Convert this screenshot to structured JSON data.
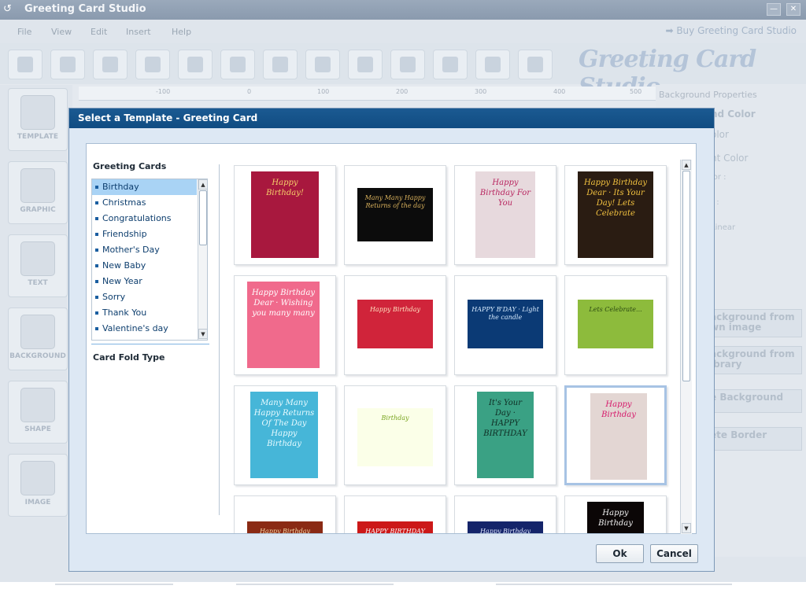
{
  "app": {
    "title": "Greeting Card Studio",
    "menus": [
      "File",
      "View",
      "Edit",
      "Insert",
      "Help"
    ],
    "buy_link": "➡ Buy Greeting Card Studio",
    "logo_text": "Greeting Card Studio",
    "ruler_ticks": [
      "-100",
      "0",
      "100",
      "200",
      "300",
      "400",
      "500"
    ],
    "side_tools": [
      "TEMPLATE",
      "GRAPHIC",
      "TEXT",
      "BACKGROUND",
      "SHAPE",
      "IMAGE"
    ],
    "right_panel": {
      "heading": "Background Properties",
      "labels": [
        "nd Color",
        "olor",
        "nt Color",
        "lor :",
        "r :",
        "Linear"
      ],
      "buttons": [
        "ackground from\nwn image",
        "ackground from\nibrary",
        "e Background",
        "ete Border"
      ]
    }
  },
  "dialog": {
    "title": "Select a Template - Greeting Card",
    "categories_heading": "Greeting Cards",
    "categories": [
      "Birthday",
      "Christmas",
      "Congratulations",
      "Friendship",
      "Mother's Day",
      "New Baby",
      "New Year",
      "Sorry",
      "Thank You",
      "Valentine's day"
    ],
    "selected_category": "Birthday",
    "fold_heading": "Card Fold Type",
    "ok_label": "Ok",
    "cancel_label": "Cancel",
    "selected_template_index": 11,
    "templates": [
      {
        "caption": "Happy Birthday!",
        "bg": "#a8183e",
        "fg": "#f7d06a"
      },
      {
        "caption": "Many Many Happy Returns of the day",
        "bg": "#0c0c0c",
        "fg": "#d9b15c"
      },
      {
        "caption": "Happy Birthday For You",
        "bg": "#e7d9dd",
        "fg": "#b8255f"
      },
      {
        "caption": "Happy Birthday Dear · Its Your Day! Lets Celebrate",
        "bg": "#2a1c12",
        "fg": "#f4c340"
      },
      {
        "caption": "Happy Birthday Dear · Wishing you many many",
        "bg": "#f06a8c",
        "fg": "#ffffff"
      },
      {
        "caption": "Happy Birthday",
        "bg": "#d0243a",
        "fg": "#ffe3c0"
      },
      {
        "caption": "HAPPY B'DAY · Light the candle",
        "bg": "#0b3a75",
        "fg": "#d8ecff"
      },
      {
        "caption": "Lets Celebrate...",
        "bg": "#8dbb3c",
        "fg": "#2b4a11"
      },
      {
        "caption": "Many Many Happy Returns Of The Day Happy Birthday",
        "bg": "#46b6d8",
        "fg": "#e9fbff"
      },
      {
        "caption": "Birthday",
        "bg": "#fbffe8",
        "fg": "#78a41e"
      },
      {
        "caption": "It's Your Day · HAPPY BIRTHDAY",
        "bg": "#3aa184",
        "fg": "#0f2c23"
      },
      {
        "caption": "Happy Birthday",
        "bg": "#e3d6d3",
        "fg": "#d6186a"
      },
      {
        "caption": "Happy Birthday",
        "bg": "#8a2a14",
        "fg": "#f6d9a6"
      },
      {
        "caption": "HAPPY BIRTHDAY",
        "bg": "#cc1818",
        "fg": "#ffffff"
      },
      {
        "caption": "Happy Birthday",
        "bg": "#14246a",
        "fg": "#e2e8ff"
      },
      {
        "caption": "Happy Birthday",
        "bg": "#0b0606",
        "fg": "#f2f2f2"
      }
    ]
  }
}
